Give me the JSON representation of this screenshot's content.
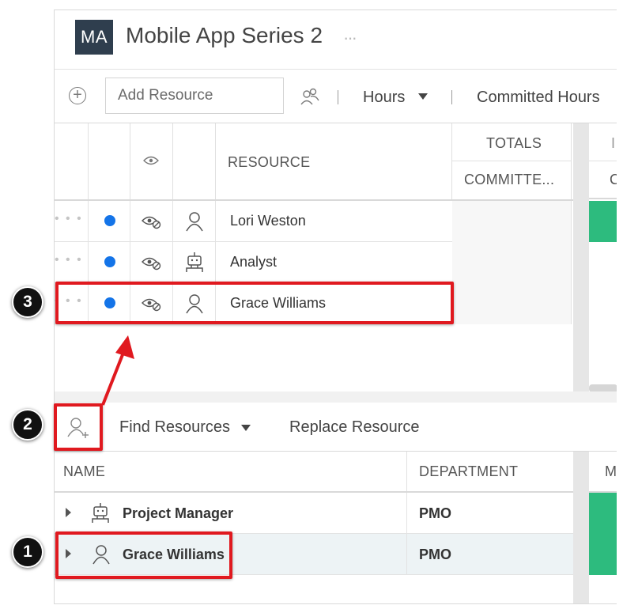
{
  "header": {
    "avatar_initials": "MA",
    "project_title": "Mobile App Series 2",
    "more_glyph": "···"
  },
  "toolbar": {
    "add_placeholder": "Add Resource",
    "hours_label": "Hours",
    "committed_label": "Committed Hours"
  },
  "upper_grid": {
    "columns": {
      "resource": "RESOURCE",
      "totals": "TOTALS",
      "committed": "COMMITTE...",
      "next_top": "I",
      "next_sub": "C"
    },
    "rows": [
      {
        "name": "Lori Weston",
        "type": "person",
        "status_color": "#1474e8"
      },
      {
        "name": "Analyst",
        "type": "generic",
        "status_color": "#1474e8"
      },
      {
        "name": "Grace Williams",
        "type": "person",
        "status_color": "#1474e8"
      }
    ]
  },
  "lower_toolbar": {
    "find_label": "Find Resources",
    "replace_label": "Replace Resource"
  },
  "lower_grid": {
    "columns": {
      "name": "NAME",
      "department": "DEPARTMENT",
      "next": "M"
    },
    "rows": [
      {
        "name": "Project Manager",
        "department": "PMO",
        "type": "generic"
      },
      {
        "name": "Grace Williams",
        "department": "PMO",
        "type": "person"
      }
    ]
  },
  "annotations": {
    "badge_1": "1",
    "badge_2": "2",
    "badge_3": "3",
    "highlight_color": "#e0191f"
  },
  "colors": {
    "accent_blue": "#1474e8",
    "green": "#2dbb7e",
    "avatar_bg": "#2f3e4e"
  }
}
